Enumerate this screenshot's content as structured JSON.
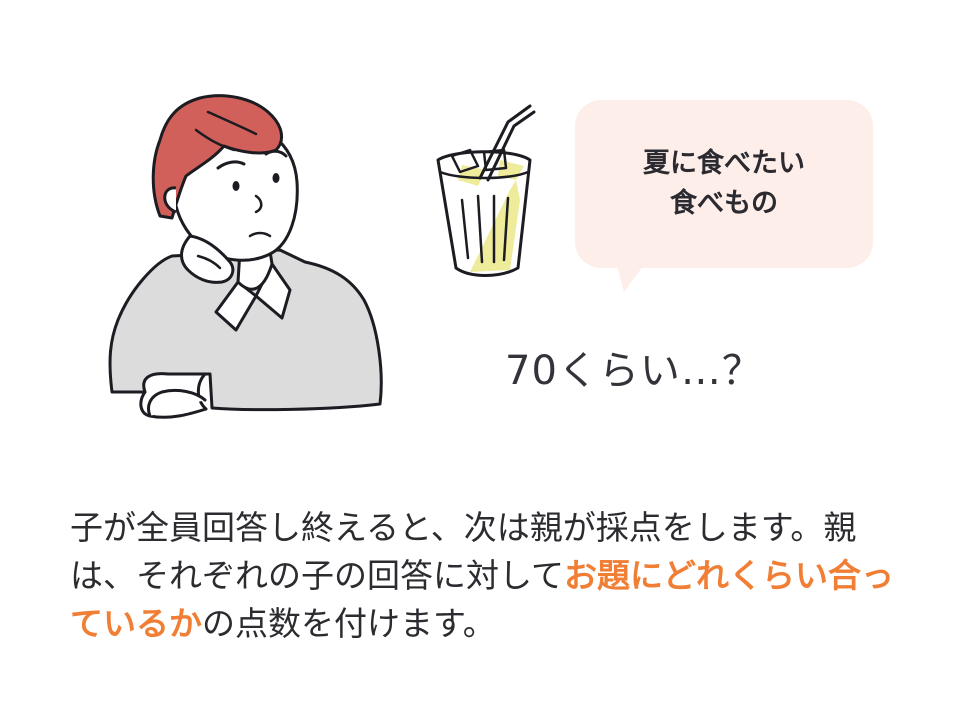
{
  "bubble": {
    "line1": "夏に食べたい",
    "line2": "食べもの"
  },
  "guess_text": "70くらい…？",
  "caption": {
    "part1": "子が全員回答し終えると、次は親が採点をします。親は、それぞれの子の回答に対して",
    "highlight": "お題にどれくらい合っているか",
    "part2": "の点数を付けます。"
  },
  "colors": {
    "hair": "#d2605a",
    "sweater": "#dcdcdc",
    "bubble_bg": "#fdeee9",
    "drink": "#eeeb9a",
    "highlight": "#f07f35",
    "line": "#1c1c22"
  },
  "icons": [
    "thinking-person-illustration",
    "iced-drink-icon"
  ]
}
